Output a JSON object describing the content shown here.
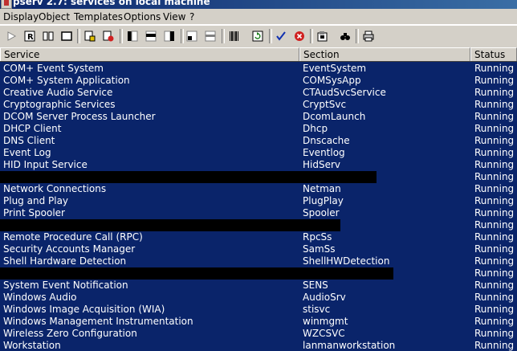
{
  "window": {
    "title": "pserv 2.7: services on local machine"
  },
  "menu": [
    "Display",
    "Object",
    "Templates",
    "Options",
    "View",
    "?"
  ],
  "columns": {
    "service": "Service",
    "section": "Section",
    "status": "Status"
  },
  "rows": [
    {
      "service": "COM+ Event System",
      "section": "EventSystem",
      "status": "Running"
    },
    {
      "service": "COM+ System Application",
      "section": "COMSysApp",
      "status": "Running"
    },
    {
      "service": "Creative Audio Service",
      "section": "CTAudSvcService",
      "status": "Running"
    },
    {
      "service": "Cryptographic Services",
      "section": "CryptSvc",
      "status": "Running"
    },
    {
      "service": "DCOM Server Process Launcher",
      "section": "DcomLaunch",
      "status": "Running"
    },
    {
      "service": "DHCP Client",
      "section": "Dhcp",
      "status": "Running"
    },
    {
      "service": "DNS Client",
      "section": "Dnscache",
      "status": "Running"
    },
    {
      "service": "Event Log",
      "section": "Eventlog",
      "status": "Running"
    },
    {
      "service": "HID Input Service",
      "section": "HidServ",
      "status": "Running"
    },
    {
      "service": "",
      "section": "",
      "status": "Running"
    },
    {
      "service": "Network Connections",
      "section": "Netman",
      "status": "Running"
    },
    {
      "service": "Plug and Play",
      "section": "PlugPlay",
      "status": "Running"
    },
    {
      "service": "Print Spooler",
      "section": "Spooler",
      "status": "Running"
    },
    {
      "service": "",
      "section": "",
      "status": "Running"
    },
    {
      "service": "Remote Procedure Call (RPC)",
      "section": "RpcSs",
      "status": "Running"
    },
    {
      "service": "Security Accounts Manager",
      "section": "SamSs",
      "status": "Running"
    },
    {
      "service": "Shell Hardware Detection",
      "section": "ShellHWDetection",
      "status": "Running"
    },
    {
      "service": "",
      "section": "",
      "status": "Running"
    },
    {
      "service": "System Event Notification",
      "section": "SENS",
      "status": "Running"
    },
    {
      "service": "Windows Audio",
      "section": "AudioSrv",
      "status": "Running"
    },
    {
      "service": "Windows Image Acquisition (WIA)",
      "section": "stisvc",
      "status": "Running"
    },
    {
      "service": "Windows Management Instrumentation",
      "section": "winmgmt",
      "status": "Running"
    },
    {
      "service": "Wireless Zero Configuration",
      "section": "WZCSVC",
      "status": "Running"
    },
    {
      "service": "Workstation",
      "section": "lanmanworkstation",
      "status": "Running"
    }
  ],
  "toolbar_icons": [
    "play-icon",
    "properties-icon",
    "stop-icon",
    "window-icon",
    "start-type-icon",
    "delete-icon",
    "view-left-icon",
    "view-center-icon",
    "view-right-icon",
    "view-small-icon",
    "view-large-icon",
    "barcode-icon",
    "refresh-icon",
    "check-icon",
    "cancel-icon",
    "install-icon",
    "find-icon",
    "print-icon"
  ],
  "colors": {
    "selection": "#0a246a",
    "chrome": "#d4d0c8",
    "redaction": "#000000"
  }
}
